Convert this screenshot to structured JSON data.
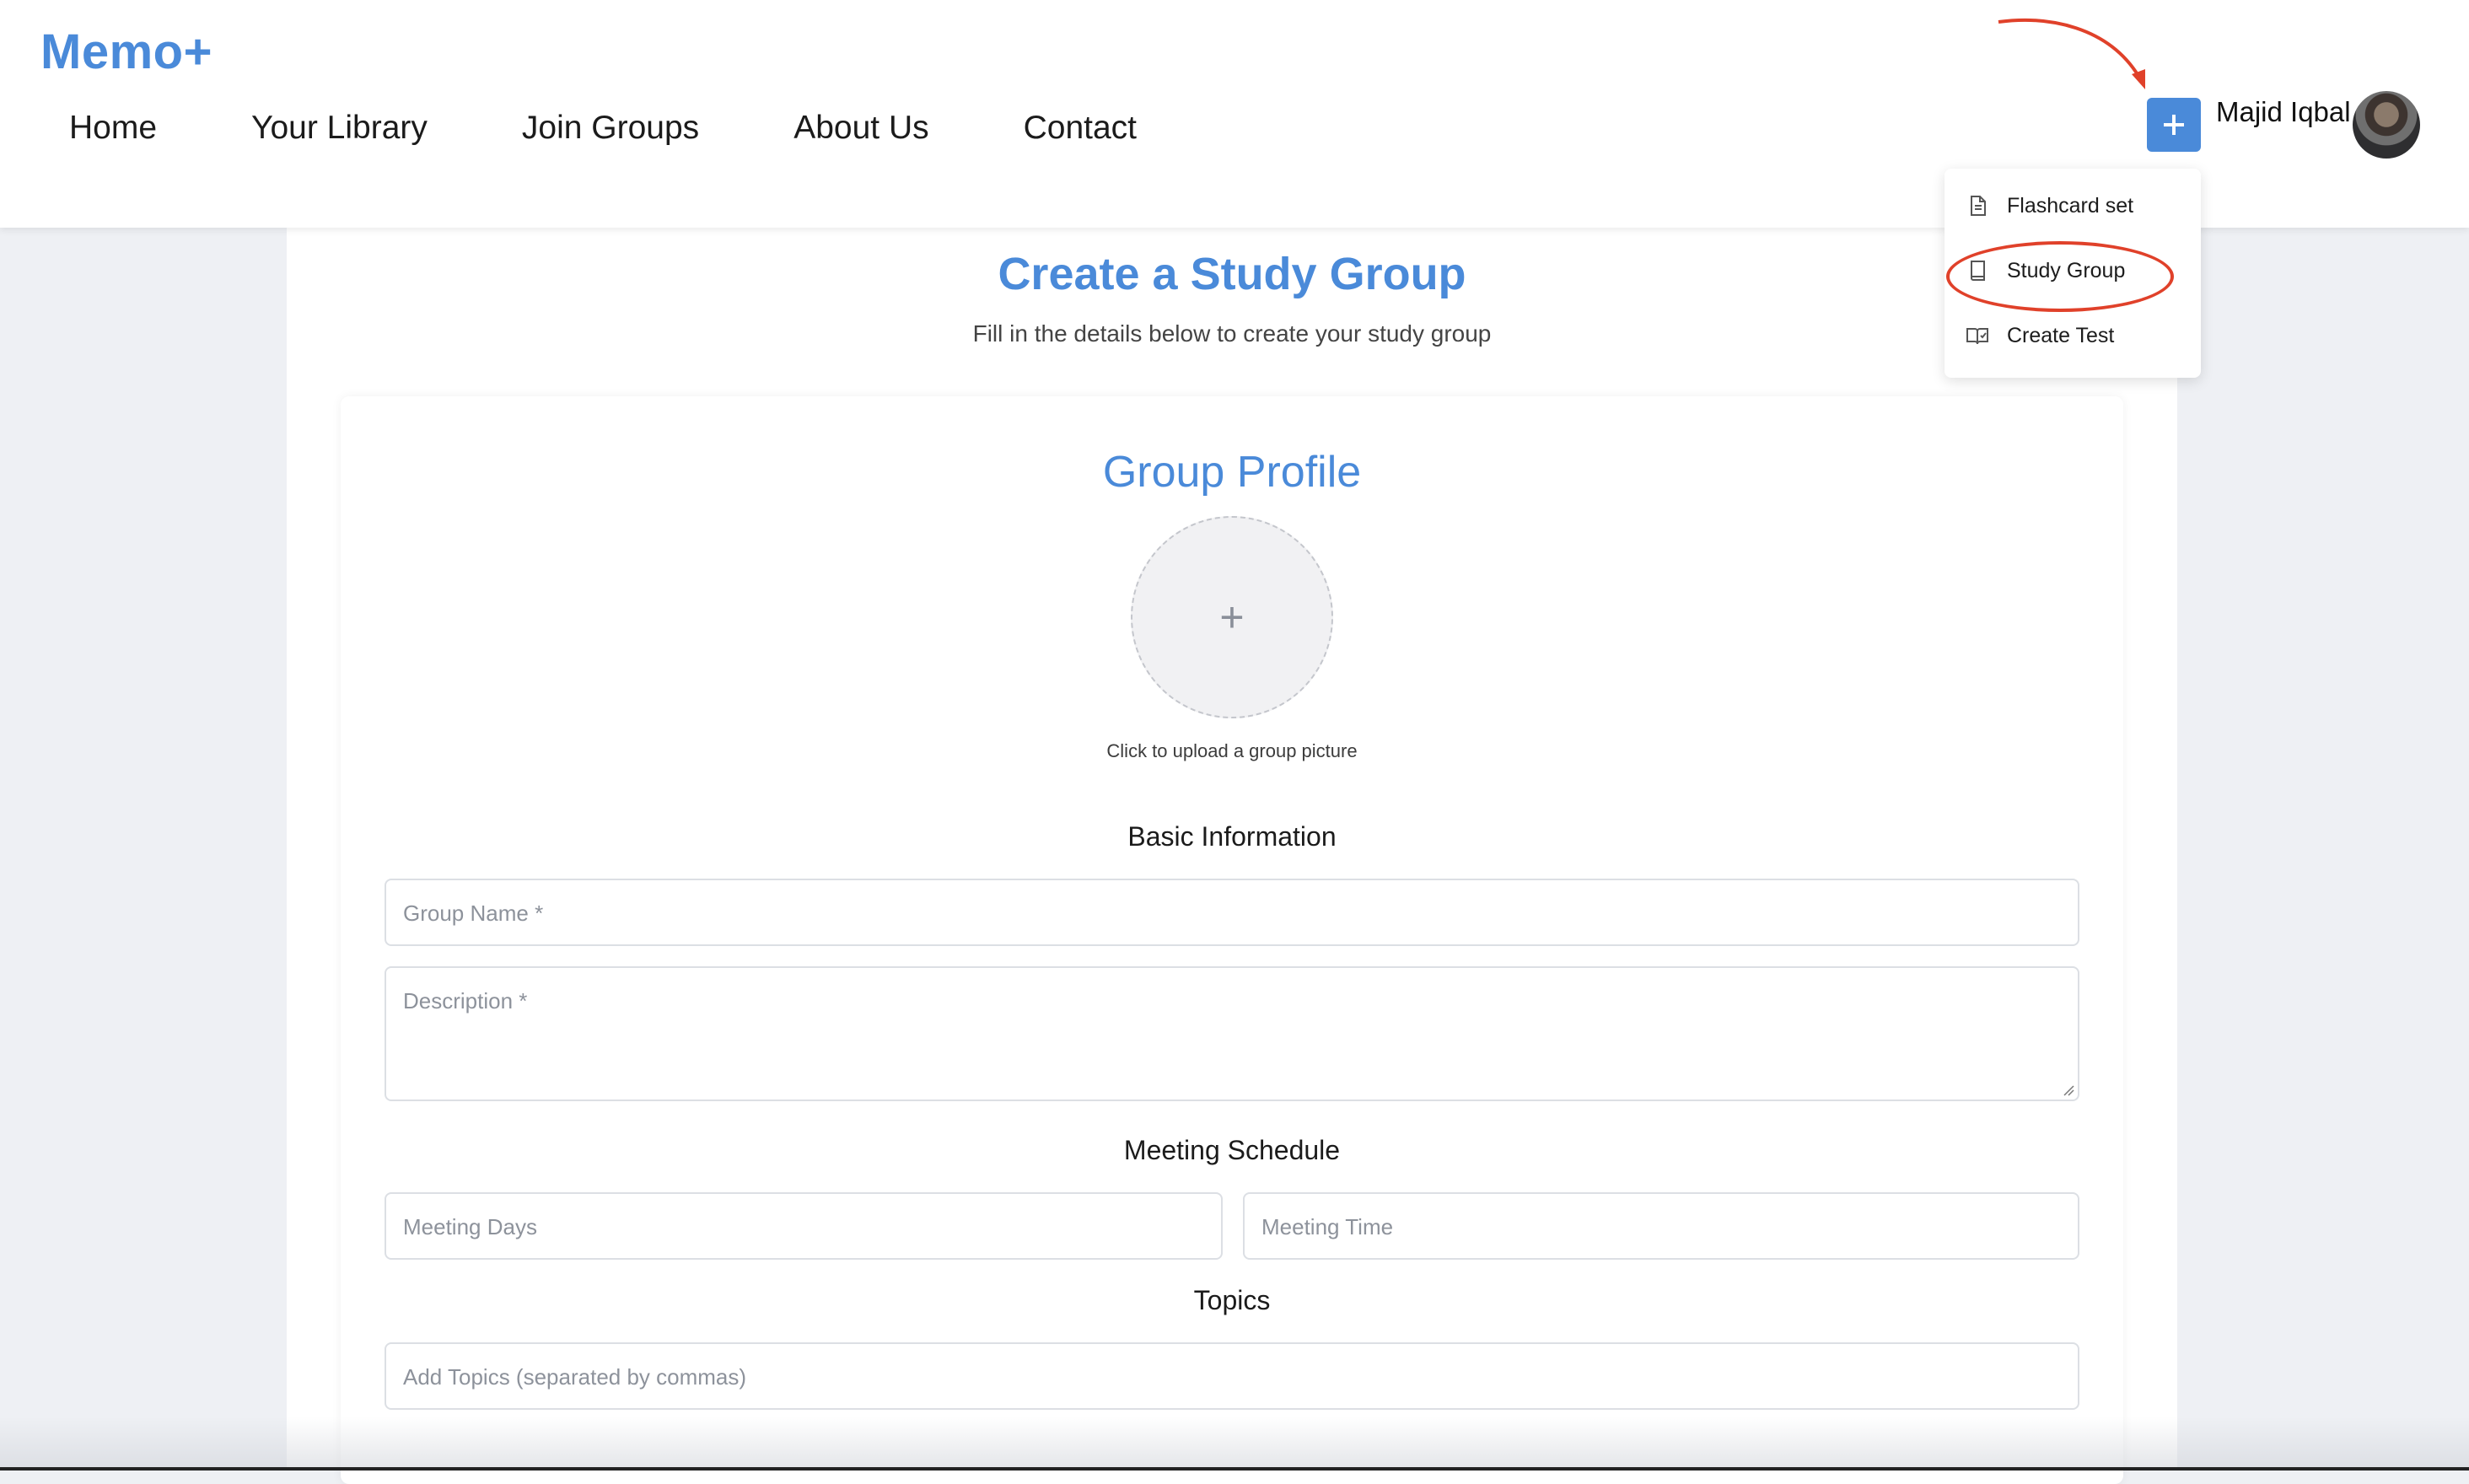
{
  "header": {
    "logo": "Memo+",
    "nav": [
      "Home",
      "Your Library",
      "Join Groups",
      "About Us",
      "Contact"
    ],
    "create_button_icon": "plus-icon",
    "user_name": "Majid Iqbal"
  },
  "dropdown": {
    "items": [
      {
        "label": "Flashcard set",
        "icon": "document-icon"
      },
      {
        "label": "Study Group",
        "icon": "book-icon"
      },
      {
        "label": "Create Test",
        "icon": "open-book-check-icon"
      }
    ]
  },
  "page": {
    "title": "Create a Study Group",
    "subtitle": "Fill in the details below to create your study group"
  },
  "form": {
    "section_title": "Group Profile",
    "upload_caption": "Click to upload a group picture",
    "basic_info_heading": "Basic Information",
    "group_name_placeholder": "Group Name *",
    "description_placeholder": "Description *",
    "schedule_heading": "Meeting Schedule",
    "meeting_days_placeholder": "Meeting Days",
    "meeting_time_placeholder": "Meeting Time",
    "topics_heading": "Topics",
    "topics_placeholder": "Add Topics (separated by commas)"
  },
  "colors": {
    "accent": "#4a8ad9",
    "annotation": "#e0412a",
    "background": "#eef0f4"
  }
}
